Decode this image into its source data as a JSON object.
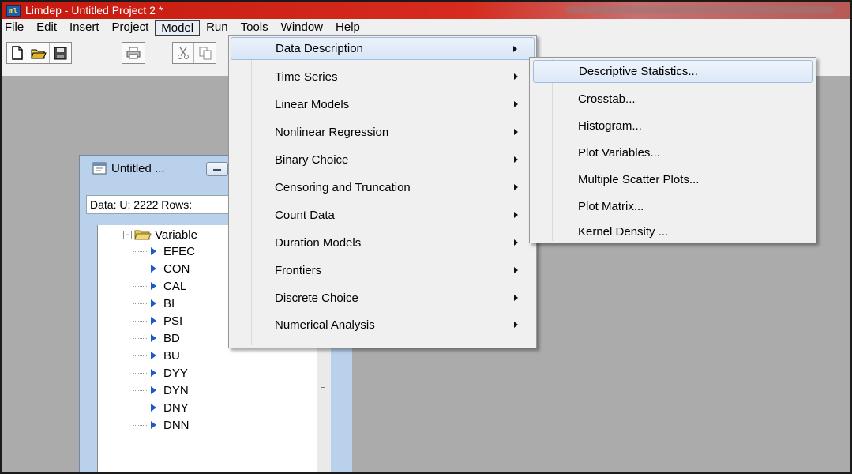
{
  "window": {
    "title": "Limdep - Untitled Project 2 *",
    "app_icon": "limdep-app-icon"
  },
  "menubar": {
    "items": [
      {
        "label": "File"
      },
      {
        "label": "Edit"
      },
      {
        "label": "Insert"
      },
      {
        "label": "Project"
      },
      {
        "label": "Model",
        "open": true
      },
      {
        "label": "Run"
      },
      {
        "label": "Tools"
      },
      {
        "label": "Window"
      },
      {
        "label": "Help"
      }
    ]
  },
  "toolbar": {
    "icons": [
      "new-file-icon",
      "open-folder-icon",
      "save-icon",
      "print-icon",
      "cut-icon",
      "copy-icon"
    ]
  },
  "child_window": {
    "title": "Untitled ...",
    "data_bar": "Data: U; 2222 Rows:",
    "tree": {
      "root": "Variable",
      "nodes": [
        "EFEC",
        "CON",
        "CAL",
        "BI",
        "PSI",
        "BD",
        "BU",
        "DYY",
        "DYN",
        "DNY",
        "DNN"
      ]
    },
    "scroll_grip": "≡"
  },
  "model_menu": {
    "items": [
      {
        "label": "Data Description",
        "submenu": true,
        "highlighted": true
      },
      {
        "label": "Time Series",
        "submenu": true
      },
      {
        "label": "Linear Models",
        "submenu": true
      },
      {
        "label": "Nonlinear Regression",
        "submenu": true
      },
      {
        "label": "Binary Choice",
        "submenu": true
      },
      {
        "label": "Censoring and Truncation",
        "submenu": true
      },
      {
        "label": "Count Data",
        "submenu": true
      },
      {
        "label": "Duration Models",
        "submenu": true
      },
      {
        "label": "Frontiers",
        "submenu": true
      },
      {
        "label": "Discrete Choice",
        "submenu": true
      },
      {
        "label": "Numerical Analysis",
        "submenu": true
      }
    ]
  },
  "data_description_menu": {
    "items": [
      {
        "label": "Descriptive Statistics...",
        "highlighted": true
      },
      {
        "label": "Crosstab..."
      },
      {
        "label": "Histogram..."
      },
      {
        "label": "Plot Variables..."
      },
      {
        "label": "Multiple Scatter Plots..."
      },
      {
        "label": "Plot Matrix..."
      },
      {
        "label": "Kernel Density ..."
      }
    ]
  },
  "colors": {
    "title_bar": "#c61a10",
    "workspace": "#ababab",
    "menu_bg": "#f0f0f0",
    "highlight_border": "#9fbde3",
    "tree_arrow": "#1b5ac8"
  }
}
